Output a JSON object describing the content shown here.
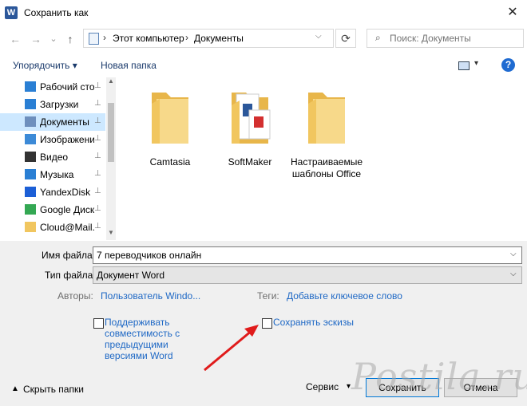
{
  "window": {
    "title": "Сохранить как",
    "close_glyph": "✕",
    "app_icon": "W"
  },
  "nav": {
    "back": "←",
    "forward": "→",
    "recent": "⌄",
    "up": "↑",
    "breadcrumbs": [
      "Этот компьютер",
      "Документы"
    ],
    "refresh": "⟳",
    "search_placeholder": "Поиск: Документы"
  },
  "toolbar": {
    "organize": "Упорядочить ▾",
    "new_folder": "Новая папка",
    "help": "?"
  },
  "sidebar": {
    "items": [
      {
        "label": "Рабочий сто",
        "icon": "desktop-icon",
        "color": "#2a7fd4"
      },
      {
        "label": "Загрузки",
        "icon": "download-icon",
        "color": "#2a7fd4"
      },
      {
        "label": "Документы",
        "icon": "document-icon",
        "color": "#6e8fbd",
        "selected": true
      },
      {
        "label": "Изображени",
        "icon": "pictures-icon",
        "color": "#3c8ad7"
      },
      {
        "label": "Видео",
        "icon": "video-icon",
        "color": "#333333"
      },
      {
        "label": "Музыка",
        "icon": "music-icon",
        "color": "#2a7fd4"
      },
      {
        "label": "YandexDisk",
        "icon": "yandexdisk-icon",
        "color": "#1c5fd6"
      },
      {
        "label": "Google Диск",
        "icon": "googledrive-icon",
        "color": "#34a853"
      },
      {
        "label": "Cloud@Mail.",
        "icon": "cloudmail-icon",
        "color": "#f1c65f"
      }
    ],
    "pin_glyph": "📌"
  },
  "files": [
    {
      "label": "Camtasia",
      "type": "folder"
    },
    {
      "label": "SoftMaker",
      "type": "folder-with-docs"
    },
    {
      "label": "Настраиваемые шаблоны Office",
      "type": "folder"
    }
  ],
  "form": {
    "filename_label": "Имя файла:",
    "filename_value": "7 переводчиков онлайн",
    "filetype_label": "Тип файла:",
    "filetype_value": "Документ Word",
    "authors_label": "Авторы:",
    "authors_value": "Пользователь Windo...",
    "tags_label": "Теги:",
    "tags_value": "Добавьте ключевое слово",
    "compat_label": "Поддерживать совместимость с предыдущими версиями Word",
    "thumbnails_label": "Сохранять эскизы"
  },
  "footer": {
    "hide_folders": "Скрыть папки",
    "service": "Сервис",
    "save": "Сохранить",
    "cancel": "Отмена"
  },
  "watermark": "Postila.ru"
}
